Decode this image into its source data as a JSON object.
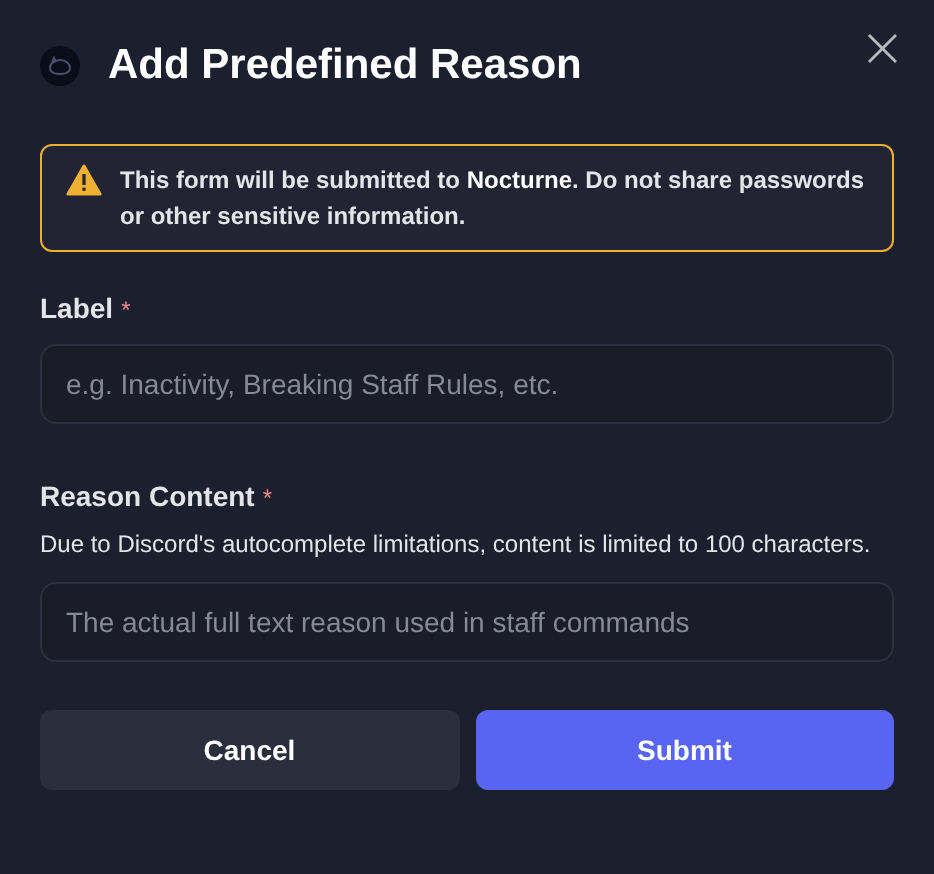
{
  "dialog": {
    "title": "Add Predefined Reason",
    "close": "×"
  },
  "warning": {
    "text": "This form will be submitted to **Nocturne**. Do not share passwords or other sensitive information."
  },
  "fields": [
    {
      "label": "Label",
      "required_mark": "*",
      "placeholder": "e.g. Inactivity, Breaking Staff Rules, etc."
    },
    {
      "label": "Reason Content",
      "required_mark": "*",
      "description": "Due to Discord's autocomplete limitations, content is limited to 100 characters.",
      "placeholder": "The actual full text reason used in staff commands"
    }
  ],
  "buttons": [
    {
      "label": "Cancel",
      "kind": "secondary"
    },
    {
      "label": "Submit",
      "kind": "primary"
    }
  ]
}
